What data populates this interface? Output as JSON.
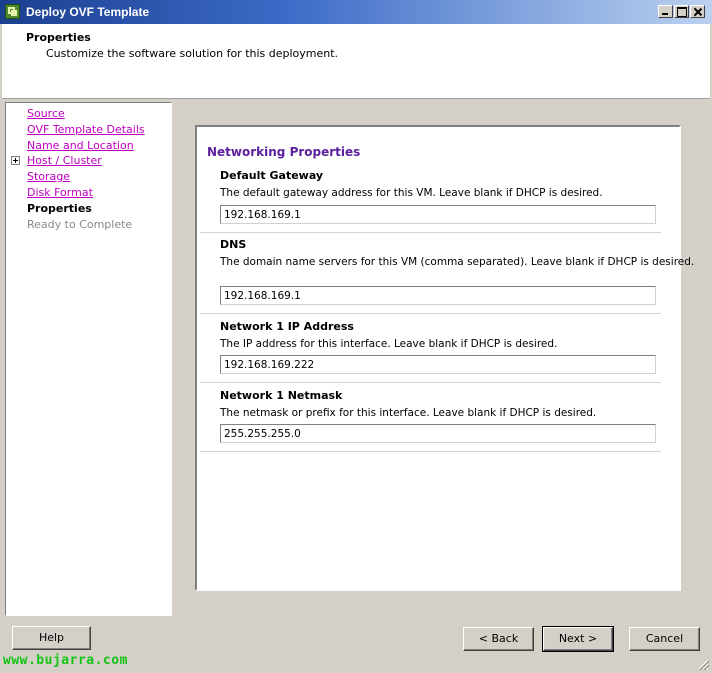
{
  "window": {
    "title": "Deploy OVF Template",
    "icon": "vsphere-app-icon"
  },
  "header": {
    "title": "Properties",
    "subtitle": "Customize the software solution for this deployment."
  },
  "nav": {
    "items": [
      {
        "label": "Source",
        "state": "link"
      },
      {
        "label": "OVF Template Details",
        "state": "link"
      },
      {
        "label": "Name and Location",
        "state": "link"
      },
      {
        "label": "Host / Cluster",
        "state": "link",
        "expander": true
      },
      {
        "label": "Storage",
        "state": "link"
      },
      {
        "label": "Disk Format",
        "state": "link"
      },
      {
        "label": "Properties",
        "state": "current"
      },
      {
        "label": "Ready to Complete",
        "state": "disabled"
      }
    ]
  },
  "main": {
    "heading": "Networking Properties",
    "properties": [
      {
        "label": "Default Gateway",
        "description": "The default gateway address for this VM. Leave blank if DHCP is desired.",
        "value": "192.168.169.1"
      },
      {
        "label": "DNS",
        "description": "The domain name servers for this VM (comma separated). Leave blank if DHCP is desired.",
        "value": "192.168.169.1"
      },
      {
        "label": "Network 1 IP Address",
        "description": "The IP address for this interface. Leave blank if DHCP is desired.",
        "value": "192.168.169.222"
      },
      {
        "label": "Network 1 Netmask",
        "description": "The netmask or prefix for this interface. Leave blank if DHCP is desired.",
        "value": "255.255.255.0"
      }
    ]
  },
  "buttons": {
    "help": "Help",
    "back": "< Back",
    "next": "Next >",
    "cancel": "Cancel"
  },
  "watermark": "www.bujarra.com",
  "colors": {
    "heading": "#5a1f9e",
    "link": "#c000c0",
    "watermark": "#13c413"
  }
}
